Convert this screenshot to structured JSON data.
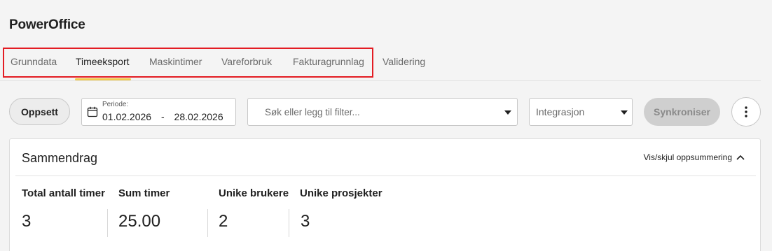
{
  "app": {
    "title": "PowerOffice"
  },
  "tabs": [
    {
      "label": "Grunndata",
      "active": false
    },
    {
      "label": "Timeeksport",
      "active": true
    },
    {
      "label": "Maskintimer",
      "active": false
    },
    {
      "label": "Vareforbruk",
      "active": false
    },
    {
      "label": "Fakturagrunnlag",
      "active": false
    },
    {
      "label": "Validering",
      "active": false
    }
  ],
  "colors": {
    "accent_underline": "#f2c94c",
    "highlight": "#e31c23"
  },
  "toolbar": {
    "setup_label": "Oppsett",
    "period": {
      "label": "Periode:",
      "from": "01.02.2026",
      "separator": "-",
      "to": "28.02.2026",
      "icon": "calendar-icon"
    },
    "search": {
      "placeholder": "Søk eller legg til filter...",
      "value": ""
    },
    "integration": {
      "label": "Integrasjon"
    },
    "sync_label": "Synkroniser",
    "more_icon": "more-vertical-icon"
  },
  "summary": {
    "title": "Sammendrag",
    "toggle_label": "Vis/skjul oppsummering",
    "stats": [
      {
        "label": "Total antall timer",
        "value": "3"
      },
      {
        "label": "Sum timer",
        "value": "25.00"
      },
      {
        "label": "Unike brukere",
        "value": "2"
      },
      {
        "label": "Unike prosjekter",
        "value": "3"
      }
    ]
  }
}
